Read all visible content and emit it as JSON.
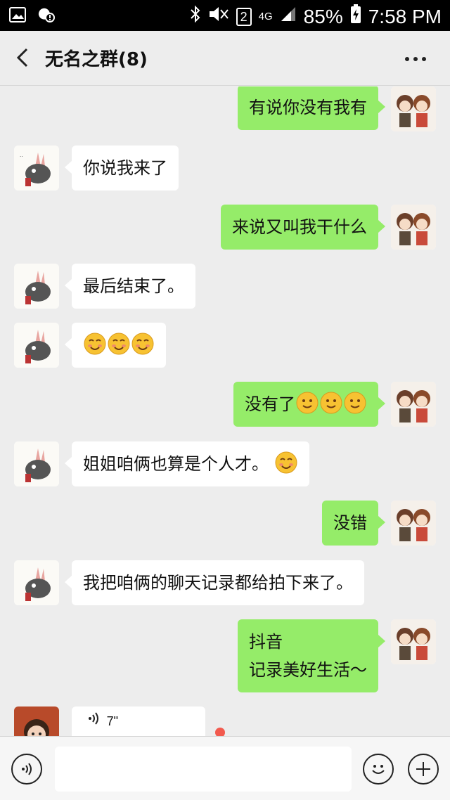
{
  "status_bar": {
    "left_icons": [
      "image-icon",
      "notification-icon"
    ],
    "sim_slot": "2",
    "network": "4G",
    "battery": "85%",
    "time": "7:58 PM"
  },
  "header": {
    "title": "无名之群(8)",
    "back_icon": "chevron-left-icon",
    "more_icon": "more-dots-icon"
  },
  "messages": [
    {
      "side": "out",
      "text": "有说你没有我有"
    },
    {
      "side": "in",
      "text": "你说我来了"
    },
    {
      "side": "out",
      "text": "来说又叫我干什么"
    },
    {
      "side": "in",
      "text": "最后结束了。"
    },
    {
      "side": "in",
      "text": "",
      "emoji": "blush-emoji",
      "emoji_count": 3
    },
    {
      "side": "out",
      "text": "没有了",
      "emoji": "smile-emoji",
      "emoji_count": 3
    },
    {
      "side": "in",
      "text": "姐姐咱俩也算是个人才。",
      "emoji": "blush-emoji",
      "emoji_count": 1
    },
    {
      "side": "out",
      "text": "没错"
    },
    {
      "side": "in",
      "text": "我把咱俩的聊天记录都给拍下来了。"
    },
    {
      "side": "out",
      "lines": [
        "抖音",
        "记录美好生活～"
      ]
    },
    {
      "side": "in",
      "type": "voice",
      "duration": "7\"",
      "unread": true
    }
  ],
  "colors": {
    "outgoing_bubble": "#95ec69",
    "incoming_bubble": "#ffffff",
    "background": "#ededed",
    "unread_dot": "#f25a4e"
  },
  "input_bar": {
    "voice_icon": "voice-toggle-icon",
    "emoji_icon": "emoji-icon",
    "plus_icon": "plus-icon",
    "placeholder": ""
  }
}
